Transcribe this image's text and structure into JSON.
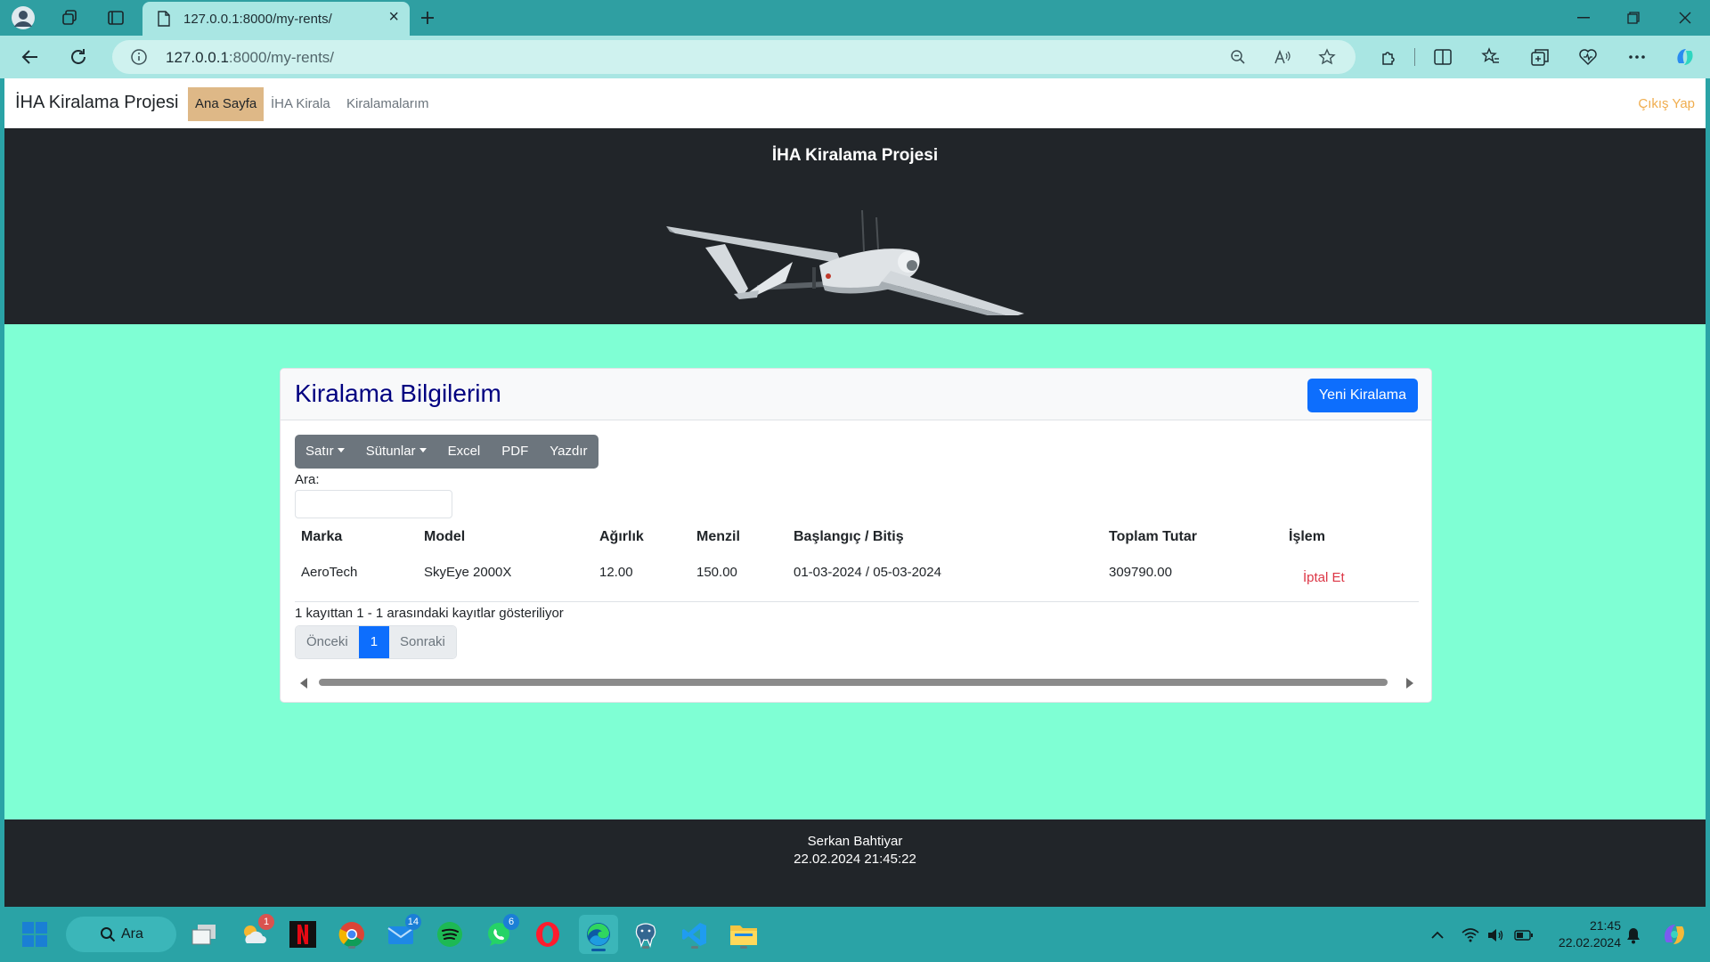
{
  "browser": {
    "tab_title": "127.0.0.1:8000/my-rents/",
    "url_host": "127.0.0.1",
    "url_rest": ":8000/my-rents/"
  },
  "navbar": {
    "brand": "İHA Kiralama Projesi",
    "links": [
      "Ana Sayfa",
      "İHA Kirala",
      "Kiralamalarım"
    ],
    "active": "Ana Sayfa",
    "logout": "Çıkış Yap"
  },
  "hero": {
    "title": "İHA Kiralama Projesi"
  },
  "card": {
    "title": "Kiralama Bilgilerim",
    "new_button": "Yeni Kiralama",
    "dt_buttons": [
      "Satır",
      "Sütunlar",
      "Excel",
      "PDF",
      "Yazdır"
    ],
    "search_label": "Ara:",
    "search_value": "",
    "columns": [
      "Marka",
      "Model",
      "Ağırlık",
      "Menzil",
      "Başlangıç / Bitiş",
      "Toplam Tutar",
      "İşlem"
    ],
    "rows": [
      {
        "brand": "AeroTech",
        "model": "SkyEye 2000X",
        "weight": "12.00",
        "range": "150.00",
        "dates": "01-03-2024 / 05-03-2024",
        "total": "309790.00",
        "action": "İptal Et"
      }
    ],
    "info": "1 kayıttan 1 - 1 arasındaki kayıtlar gösteriliyor",
    "pager": {
      "prev": "Önceki",
      "page": "1",
      "next": "Sonraki"
    }
  },
  "footer": {
    "author": "Serkan Bahtiyar",
    "datetime": "22.02.2024 21:45:22"
  },
  "taskbar": {
    "search": "Ara",
    "weather_badge": "1",
    "mail_badge": "14",
    "whatsapp_badge": "6",
    "time": "21:45",
    "date": "22.02.2024"
  },
  "colors": {
    "page_bg": "#7fffd4",
    "dark": "#212529",
    "primary": "#0d6efd",
    "title": "#000080",
    "active_nav": "#deb887",
    "logout": "#f0ad4e",
    "danger": "#dc3545"
  }
}
